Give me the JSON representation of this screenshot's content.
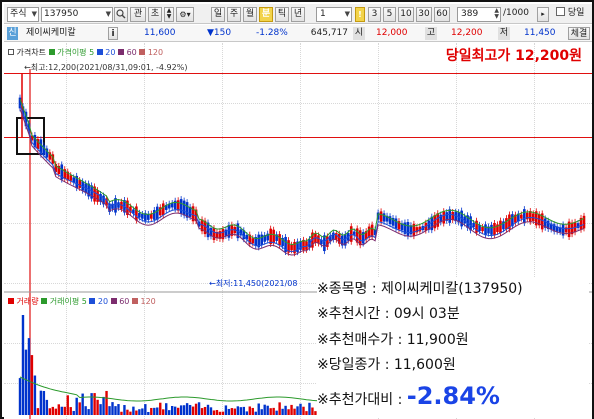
{
  "toolbar": {
    "market_select": "주식",
    "stock_code": "137950",
    "search_label": "관",
    "reset_label": "초",
    "period_buttons": [
      "일",
      "주",
      "월",
      "분",
      "틱",
      "년"
    ],
    "active_period": "분",
    "interval_value": "1",
    "interval_buttons": [
      "3",
      "5",
      "10",
      "30",
      "60"
    ],
    "count_value": "389",
    "count_max": "/1000",
    "same_day_label": "당일"
  },
  "quote_bar": {
    "tag": "신",
    "stock_name": "제이씨케미칼",
    "info_icon": "i",
    "price": "11,600",
    "change": "▼150",
    "change_pct": "-1.28%",
    "volume": "645,717",
    "open_label": "시",
    "open": "12,000",
    "high_label": "고",
    "high": "12,200",
    "low_label": "저",
    "low": "11,450",
    "exec_label": "체결"
  },
  "price_panel": {
    "legend": [
      "가격차트",
      "가격이평",
      "5",
      "20",
      "60",
      "120"
    ],
    "max_label": "←최고:12,200(2021/08/31,09:01, -4.92%)",
    "min_label": "←최저:11,450(2021/08",
    "headline": "당일최고가 12,200원"
  },
  "volume_panel": {
    "legend": [
      "거래량",
      "거래이평",
      "5",
      "20",
      "60",
      "120"
    ]
  },
  "overlay": {
    "line1": "※종목명 : 제이씨케미칼(137950)",
    "line2": "※추천시간 : 09시 03분",
    "line3": "※추천매수가 : 11,900원",
    "line4": "※당일종가 : 11,600원",
    "line5_label": "※추천가대비 : ",
    "line5_value": "-2.84%"
  },
  "colors": {
    "up": "#e00000",
    "down": "#0033cc",
    "accent": "#1a44e6",
    "ma5": "#2c9a2c",
    "ma20": "#1d4fd8",
    "ma60": "#7c2d6e",
    "ma120": "#c06060"
  }
}
